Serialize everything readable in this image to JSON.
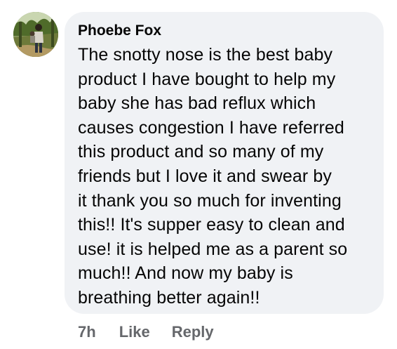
{
  "comment": {
    "author": "Phoebe Fox",
    "text_lines": [
      "The snotty nose is the best baby",
      "product I have bought to help my",
      "baby she has bad reflux which",
      "causes congestion I have referred",
      "this product and so many of my",
      "friends but I love it and swear by",
      "it thank you so much for inventing",
      "this!! It's supper easy to clean and",
      "use! it is helped me as a parent so",
      "much!! And now my baby is",
      "breathing better again!!"
    ],
    "avatar_icon": "profile-photo",
    "bubble_color": "#f0f2f5",
    "text_color": "#050505",
    "meta_color": "#65676b"
  },
  "actions": {
    "time": "7h",
    "like_label": "Like",
    "reply_label": "Reply"
  }
}
